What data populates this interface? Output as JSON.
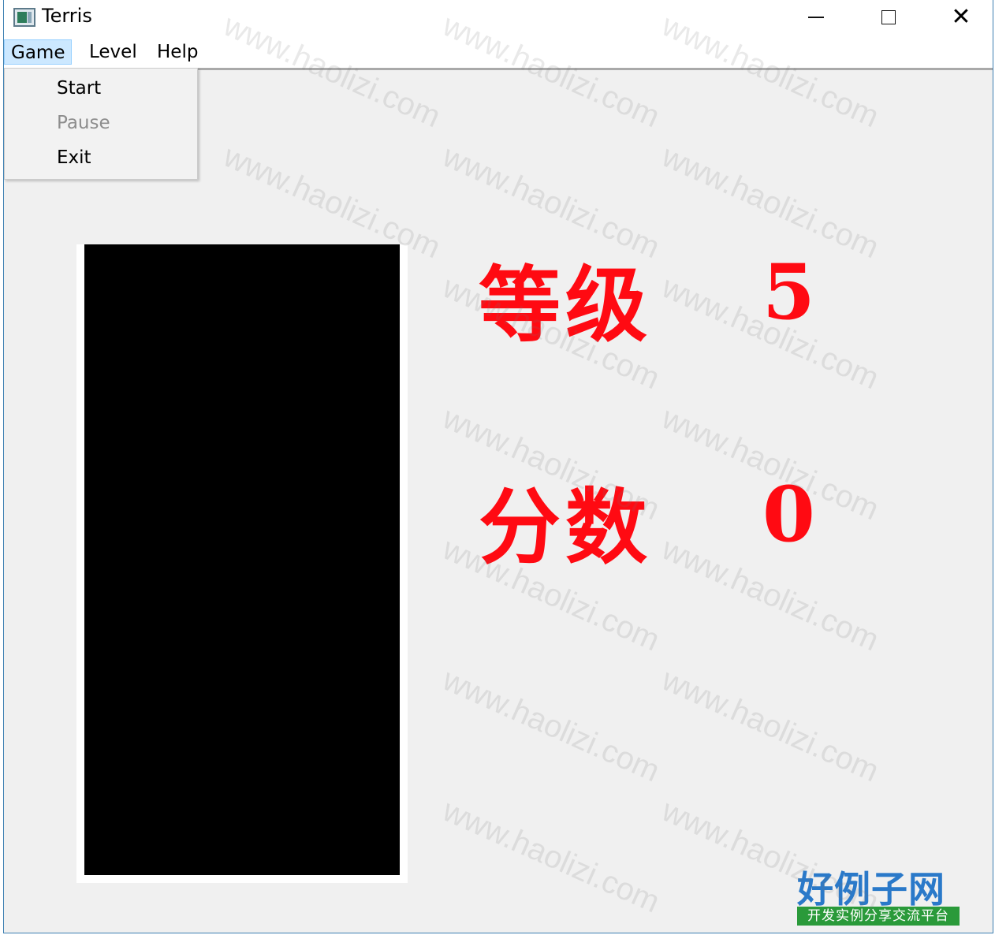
{
  "window": {
    "title": "Terris",
    "controls": {
      "minimize": "minimize-icon",
      "maximize": "maximize-icon",
      "close": "close-icon"
    }
  },
  "menubar": {
    "items": [
      {
        "label": "Game"
      },
      {
        "label": "Level"
      },
      {
        "label": "Help"
      }
    ]
  },
  "game_menu": {
    "items": [
      {
        "label": "Start",
        "enabled": true
      },
      {
        "label": "Pause",
        "enabled": false
      },
      {
        "label": "Exit",
        "enabled": true
      }
    ]
  },
  "stats": {
    "level_label": "等级",
    "level_value": "5",
    "score_label": "分数",
    "score_value": "0"
  },
  "branding": {
    "logo_text": "好例子网",
    "logo_tagline": "开发实例分享交流平台",
    "watermark": "www.haolizi.com"
  },
  "colors": {
    "stat_text": "#ff0a12",
    "board": "#000000",
    "menu_highlight": "#cce8ff"
  }
}
